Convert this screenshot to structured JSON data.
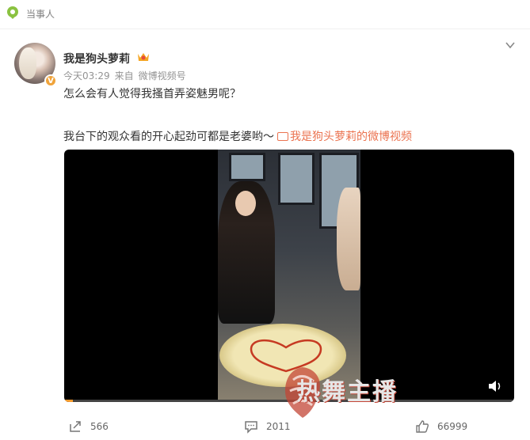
{
  "topbar": {
    "label": "当事人",
    "icon": "location-pin-icon"
  },
  "post": {
    "username": "我是狗头萝莉",
    "badge": "V",
    "time": "今天03:29",
    "source_prefix": "来自",
    "source": "微博视频号",
    "text_line1": "怎么会有人觉得我搔首弄姿魅男呢？",
    "text_line2": "我台下的观众看的开心起劲可都是老婆哟～",
    "video_link": "我是狗头萝莉的微博视频"
  },
  "video": {
    "progress_fraction": 0.02,
    "watermark": "热舞主播"
  },
  "actions": {
    "forward": "566",
    "comment": "2011",
    "like": "66999"
  },
  "colors": {
    "link": "#eb7350",
    "badge": "#f0a33a",
    "progress": "#f89c2f"
  }
}
